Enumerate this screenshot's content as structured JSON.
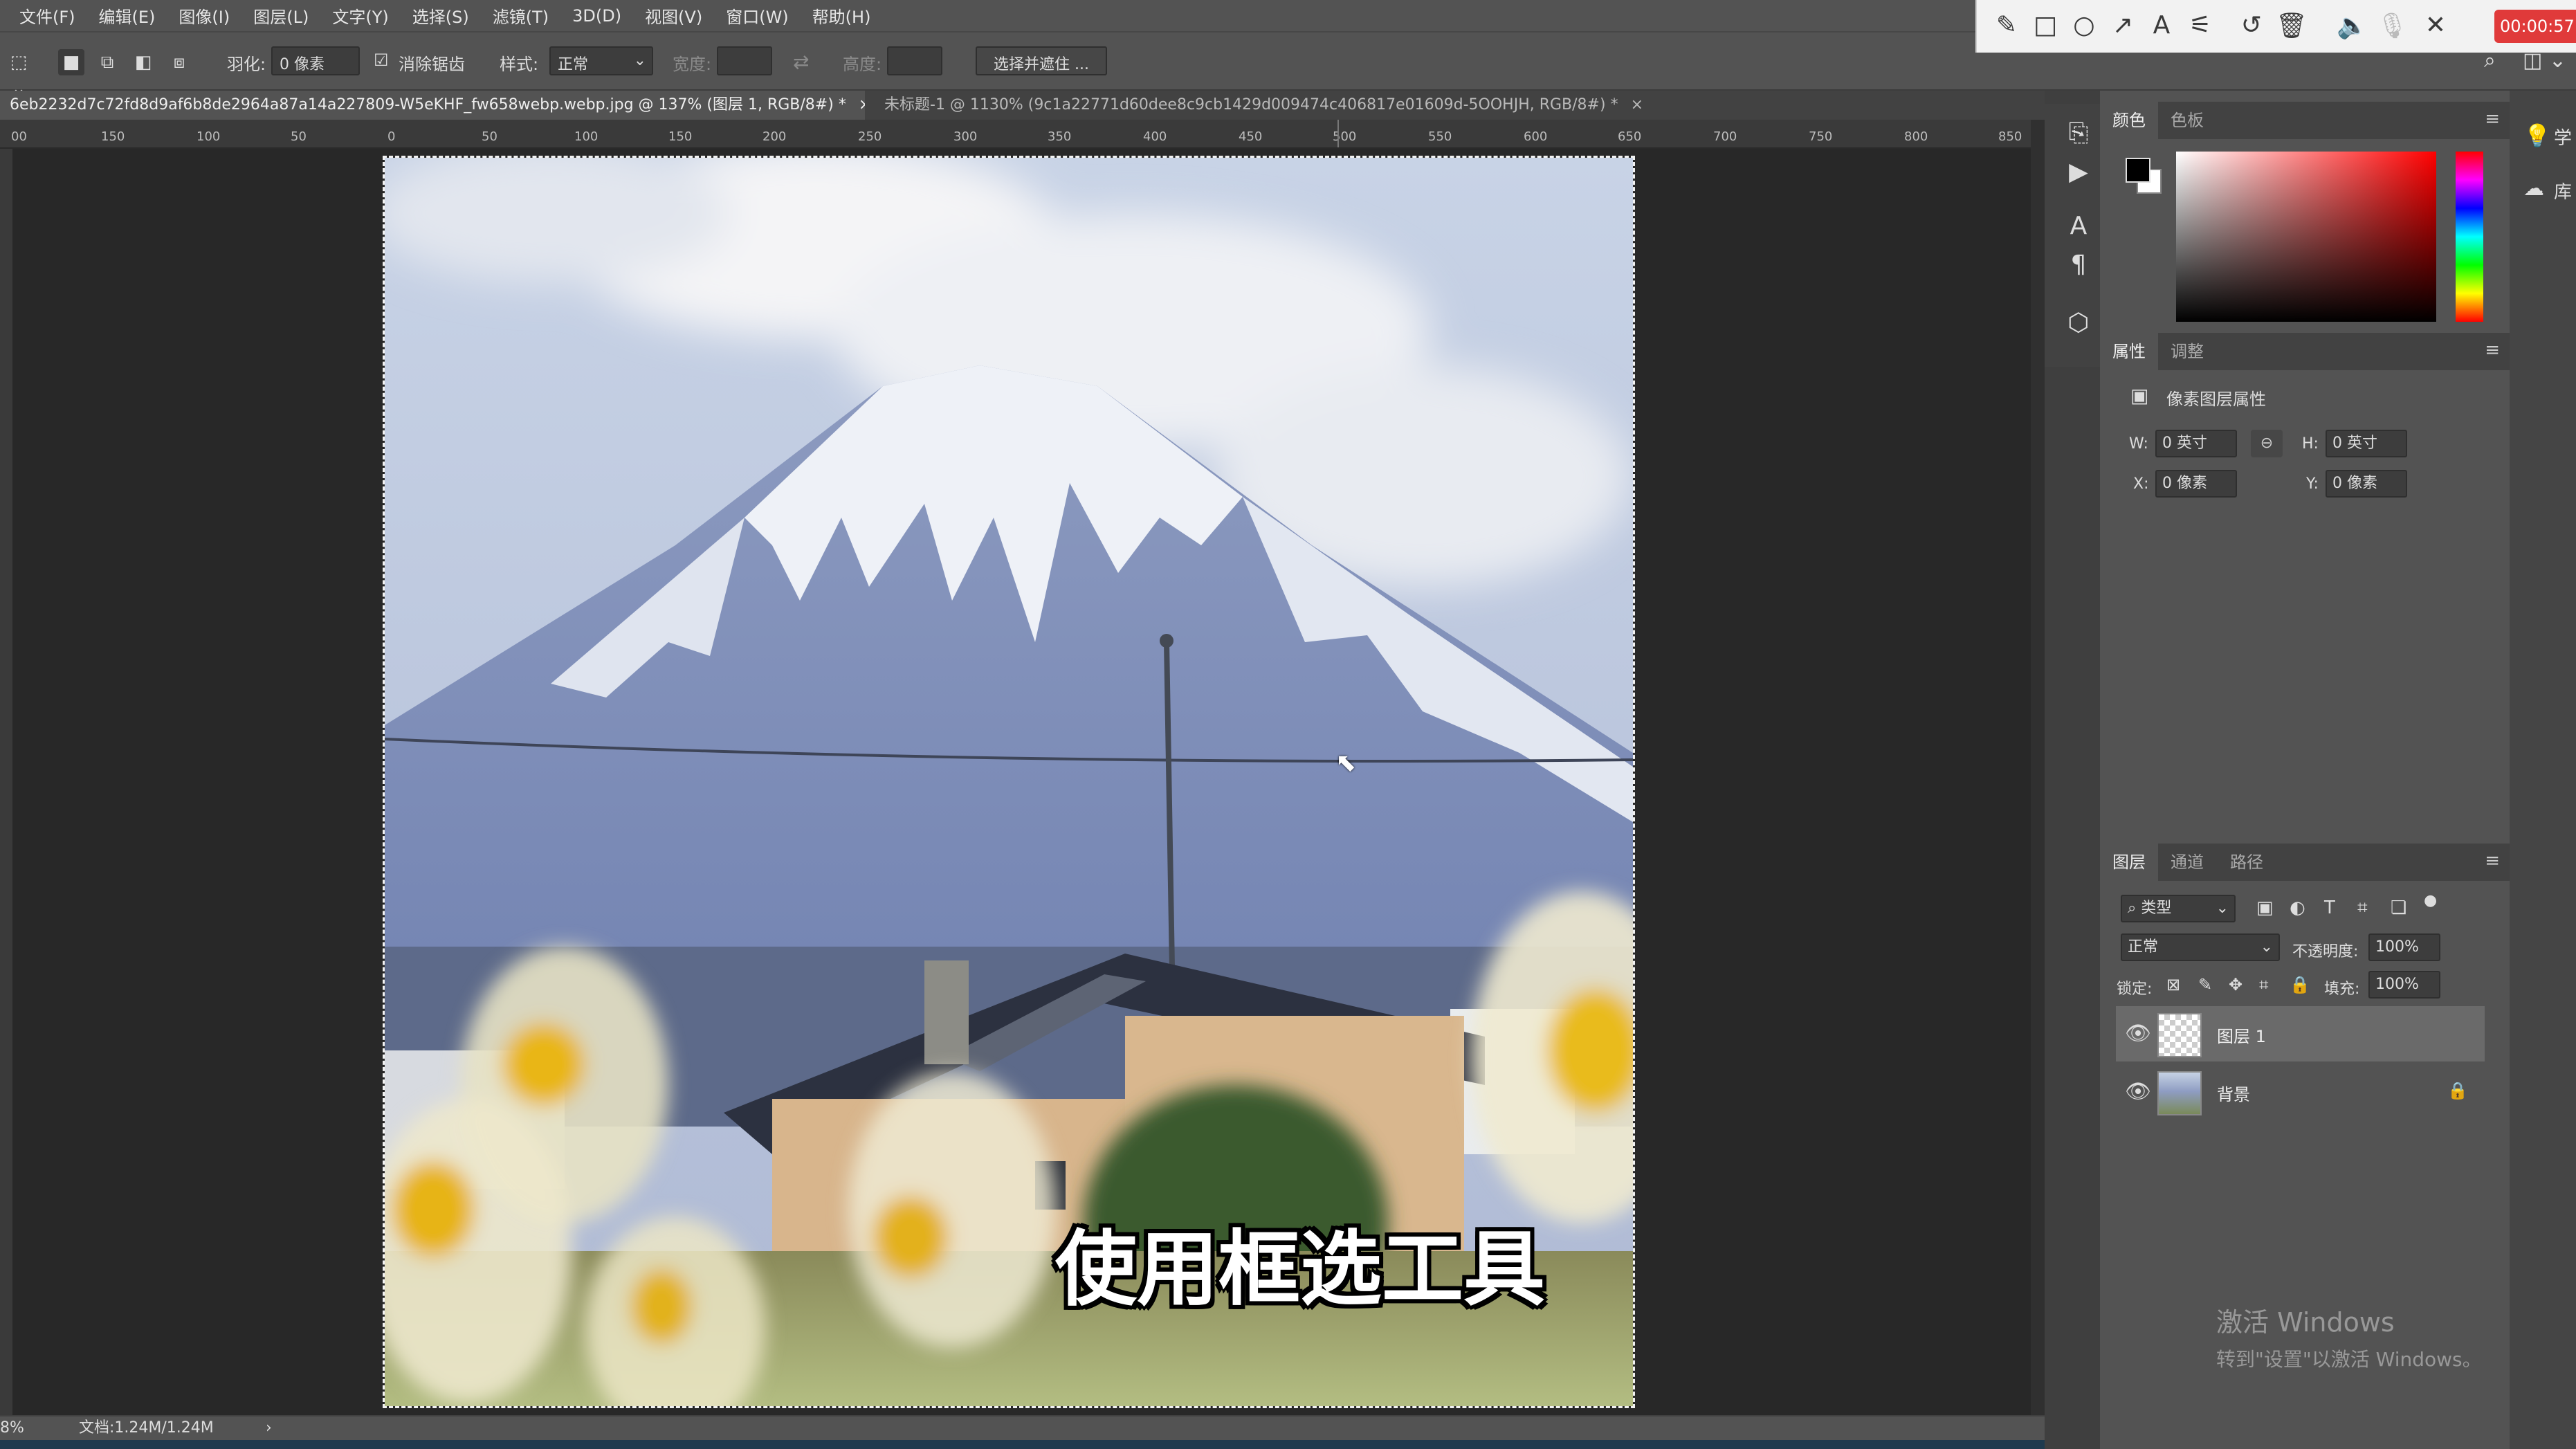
{
  "menu": [
    "文件(F)",
    "编辑(E)",
    "图像(I)",
    "图层(L)",
    "文字(Y)",
    "选择(S)",
    "滤镜(T)",
    "3D(D)",
    "视图(V)",
    "窗口(W)",
    "帮助(H)"
  ],
  "options": {
    "feather_label": "羽化:",
    "feather_value": "0 像素",
    "antialias_label": "消除锯齿",
    "style_label": "样式:",
    "style_value": "正常",
    "width_label": "宽度:",
    "height_label": "高度:",
    "select_mask_button": "选择并遮住 ..."
  },
  "tabs": [
    {
      "title": "6eb2232d7c72fd8d9af6b8de2964a87a14a227809-W5eKHF_fw658webp.webp.jpg @ 137% (图层 1, RGB/8#) *",
      "active": true
    },
    {
      "title": "未标题-1 @ 1130% (9c1a22771d60dee8c9cb1429d009474c406817e01609d-5OOHJH, RGB/8#) *",
      "active": false
    }
  ],
  "ruler_ticks": [
    "00",
    "150",
    "100",
    "50",
    "0",
    "50",
    "100",
    "150",
    "200",
    "250",
    "300",
    "350",
    "400",
    "450",
    "500",
    "550",
    "600",
    "650",
    "700",
    "750",
    "800",
    "850"
  ],
  "canvas": {
    "caption": "使用框选工具"
  },
  "status": {
    "zoom": "8%",
    "doc": "文档:1.24M/1.24M",
    "arrow": "›"
  },
  "recorder": {
    "timer": "00:00:57",
    "icons": [
      "pencil-icon",
      "square-icon",
      "circle-icon",
      "arrow-icon",
      "text-icon",
      "magic-wand-icon",
      "undo-icon",
      "trash-icon",
      "speaker-icon",
      "mic-icon",
      "close-icon"
    ]
  },
  "color_panel": {
    "tabs": [
      "颜色",
      "色板"
    ],
    "foreground": "#000000",
    "background": "#ffffff",
    "hue": "#ff0000"
  },
  "properties_panel": {
    "tabs": [
      "属性",
      "调整"
    ],
    "title": "像素图层属性",
    "w_label": "W:",
    "w_value": "0 英寸",
    "h_label": "H:",
    "h_value": "0 英寸",
    "x_label": "X:",
    "x_value": "0 像素",
    "y_label": "Y:",
    "y_value": "0 像素"
  },
  "layers_panel": {
    "tabs": [
      "图层",
      "通道",
      "路径"
    ],
    "filter_value": "类型",
    "blend_mode": "正常",
    "opacity_label": "不透明度:",
    "opacity_value": "100%",
    "lock_label": "锁定:",
    "fill_label": "填充:",
    "fill_value": "100%",
    "layers": [
      {
        "name": "图层 1",
        "selected": true,
        "locked": false
      },
      {
        "name": "背景",
        "selected": false,
        "locked": true
      }
    ]
  },
  "watermark": {
    "line1": "激活 Windows",
    "line2": "转到\"设置\"以激活 Windows。"
  },
  "right_strip_labels": [
    "学",
    "库"
  ]
}
